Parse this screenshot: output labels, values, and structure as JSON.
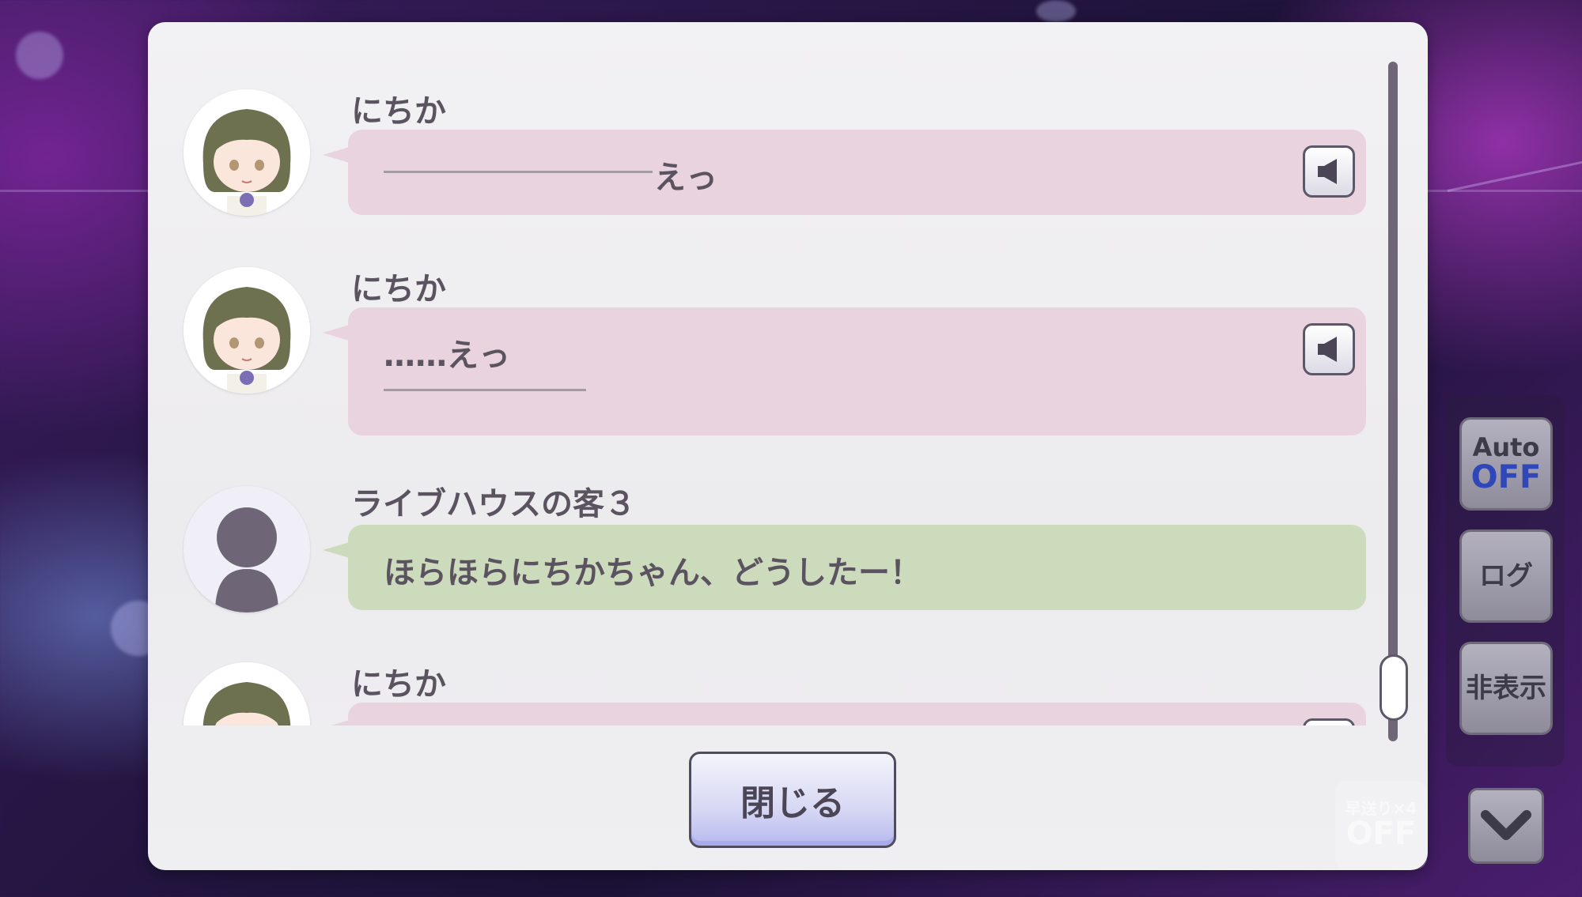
{
  "log": {
    "entries": [
      {
        "speaker": "にちか",
        "avatar": "nichika-avatar",
        "text": "えっ",
        "style": "pink",
        "has_voice": true
      },
      {
        "speaker": "にちか",
        "avatar": "nichika-avatar",
        "text": "……えっ",
        "style": "pink",
        "has_voice": true
      },
      {
        "speaker": "ライブハウスの客３",
        "avatar": "silhouette-avatar",
        "text": "ほらほらにちかちゃん、どうしたー！",
        "style": "green",
        "has_voice": false
      },
      {
        "speaker": "にちか",
        "avatar": "nichika-avatar",
        "text": "",
        "style": "pink",
        "has_voice": true
      }
    ]
  },
  "dialog": {
    "close_label": "閉じる"
  },
  "side_menu": {
    "auto_top": "Auto",
    "auto_state": "OFF",
    "log_label": "ログ",
    "hide_label": "非表示",
    "fast_forward_top": "早送り×4",
    "fast_forward_state": "OFF"
  },
  "colors": {
    "bubble_pink": "#e9d3de",
    "bubble_green": "#cddbbd",
    "auto_off": "#2f47b8",
    "text": "#5b5460"
  },
  "icons": [
    "speaker-icon",
    "chevron-down-icon",
    "silhouette-icon"
  ]
}
